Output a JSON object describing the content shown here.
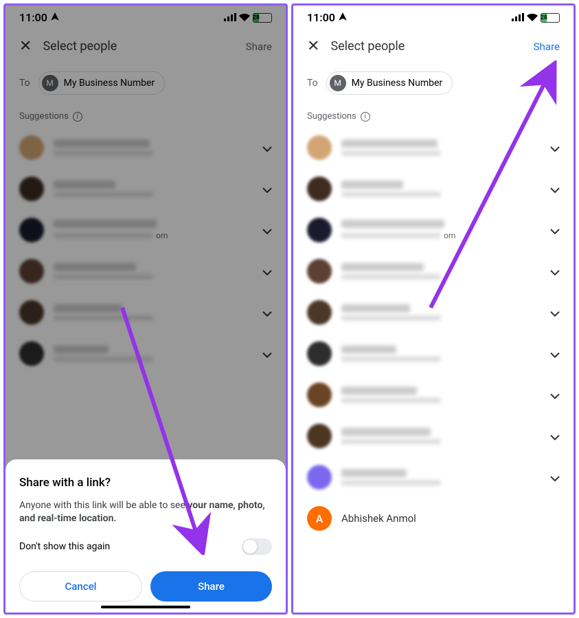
{
  "status": {
    "time": "11:00",
    "battery": "28"
  },
  "nav": {
    "title": "Select people",
    "share": "Share"
  },
  "to": {
    "label": "To",
    "chip_initial": "M",
    "chip_name": "My Business Number"
  },
  "suggestions_label": "Suggestions",
  "contacts": {
    "avatars": [
      "#d4a574",
      "#3d2b1f",
      "#1a1a2e",
      "#5c4033",
      "#4a3728",
      "#2d2d2d",
      "#6b4423",
      "#4b3621",
      "#7b68ee"
    ],
    "visible_subtext": "om",
    "last_name": "Abhishek Anmol",
    "last_initial": "A"
  },
  "sheet": {
    "title": "Share with a link?",
    "body_pre": "Anyone with this link will be able to see ",
    "body_bold": "your name, photo, and real-time location.",
    "dont_show": "Don't show this again",
    "cancel": "Cancel",
    "share": "Share"
  }
}
